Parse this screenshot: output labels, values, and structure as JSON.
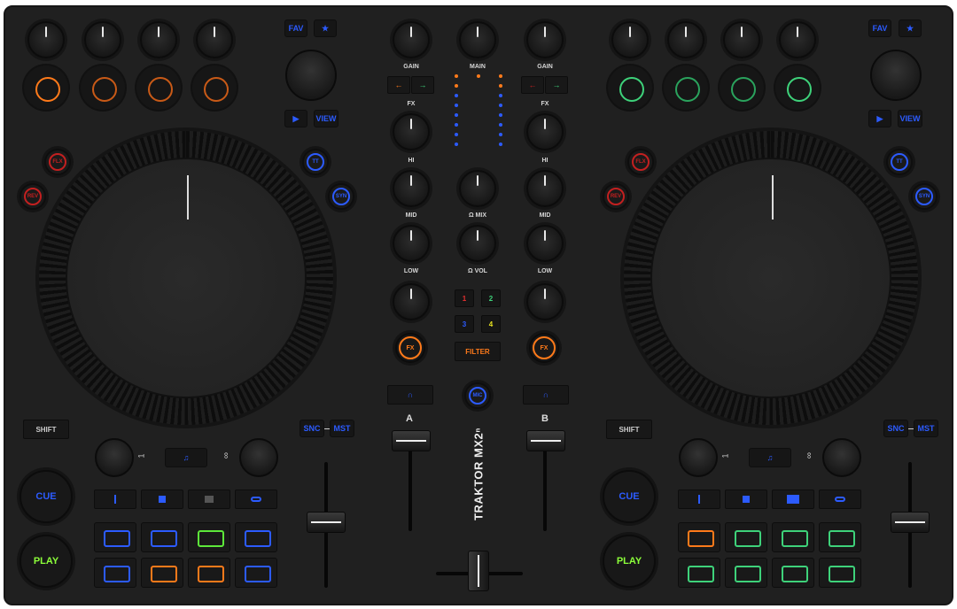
{
  "mixer": {
    "gain_left": "GAIN",
    "main": "MAIN",
    "gain_right": "GAIN",
    "fx_left": "FX",
    "fx_right": "FX",
    "hi_left": "HI",
    "hi_right": "HI",
    "mid_left": "MID",
    "mid_right": "MID",
    "hp_mix": "Ω MIX",
    "low_left": "LOW",
    "low_right": "LOW",
    "hp_vol": "Ω VOL",
    "fx_button": "FX",
    "filter": "FILTER",
    "num_buttons": [
      "1",
      "2",
      "3",
      "4"
    ],
    "channel_a": "A",
    "channel_b": "B",
    "brand": "TRAKTOR MX2ⁿ",
    "center_button": "MIC",
    "arrow_left": "←",
    "arrow_right": "→",
    "headphone": "∩"
  },
  "deck_left": {
    "fav": "FAV",
    "star": "★",
    "play_small": "▶",
    "view": "VIEW",
    "flux": "FLX",
    "rev": "REV",
    "tt": "TT",
    "sync_small": "SYN",
    "shift": "SHIFT",
    "sync": "SNC",
    "master": "MST",
    "cue": "CUE",
    "play": "PLAY",
    "note": "♫",
    "one": "1",
    "loop": "∞"
  },
  "deck_right": {
    "fav": "FAV",
    "star": "★",
    "play_small": "▶",
    "view": "VIEW",
    "flux": "FLX",
    "rev": "REV",
    "tt": "TT",
    "sync_small": "SYN",
    "shift": "SHIFT",
    "sync": "SNC",
    "master": "MST",
    "cue": "CUE",
    "play": "PLAY",
    "note": "♫",
    "one": "1",
    "loop": "∞"
  },
  "colors": {
    "blue": "#2c5bff",
    "orange": "#ff7a1a",
    "green": "#3ed27a",
    "lime": "#8cff3a",
    "red": "#c32020",
    "yellow": "#e6e220"
  },
  "icons": [
    "headphone-icon",
    "arrow-left-icon",
    "arrow-right-icon",
    "play-icon",
    "star-icon",
    "note-icon",
    "loop-icon"
  ]
}
